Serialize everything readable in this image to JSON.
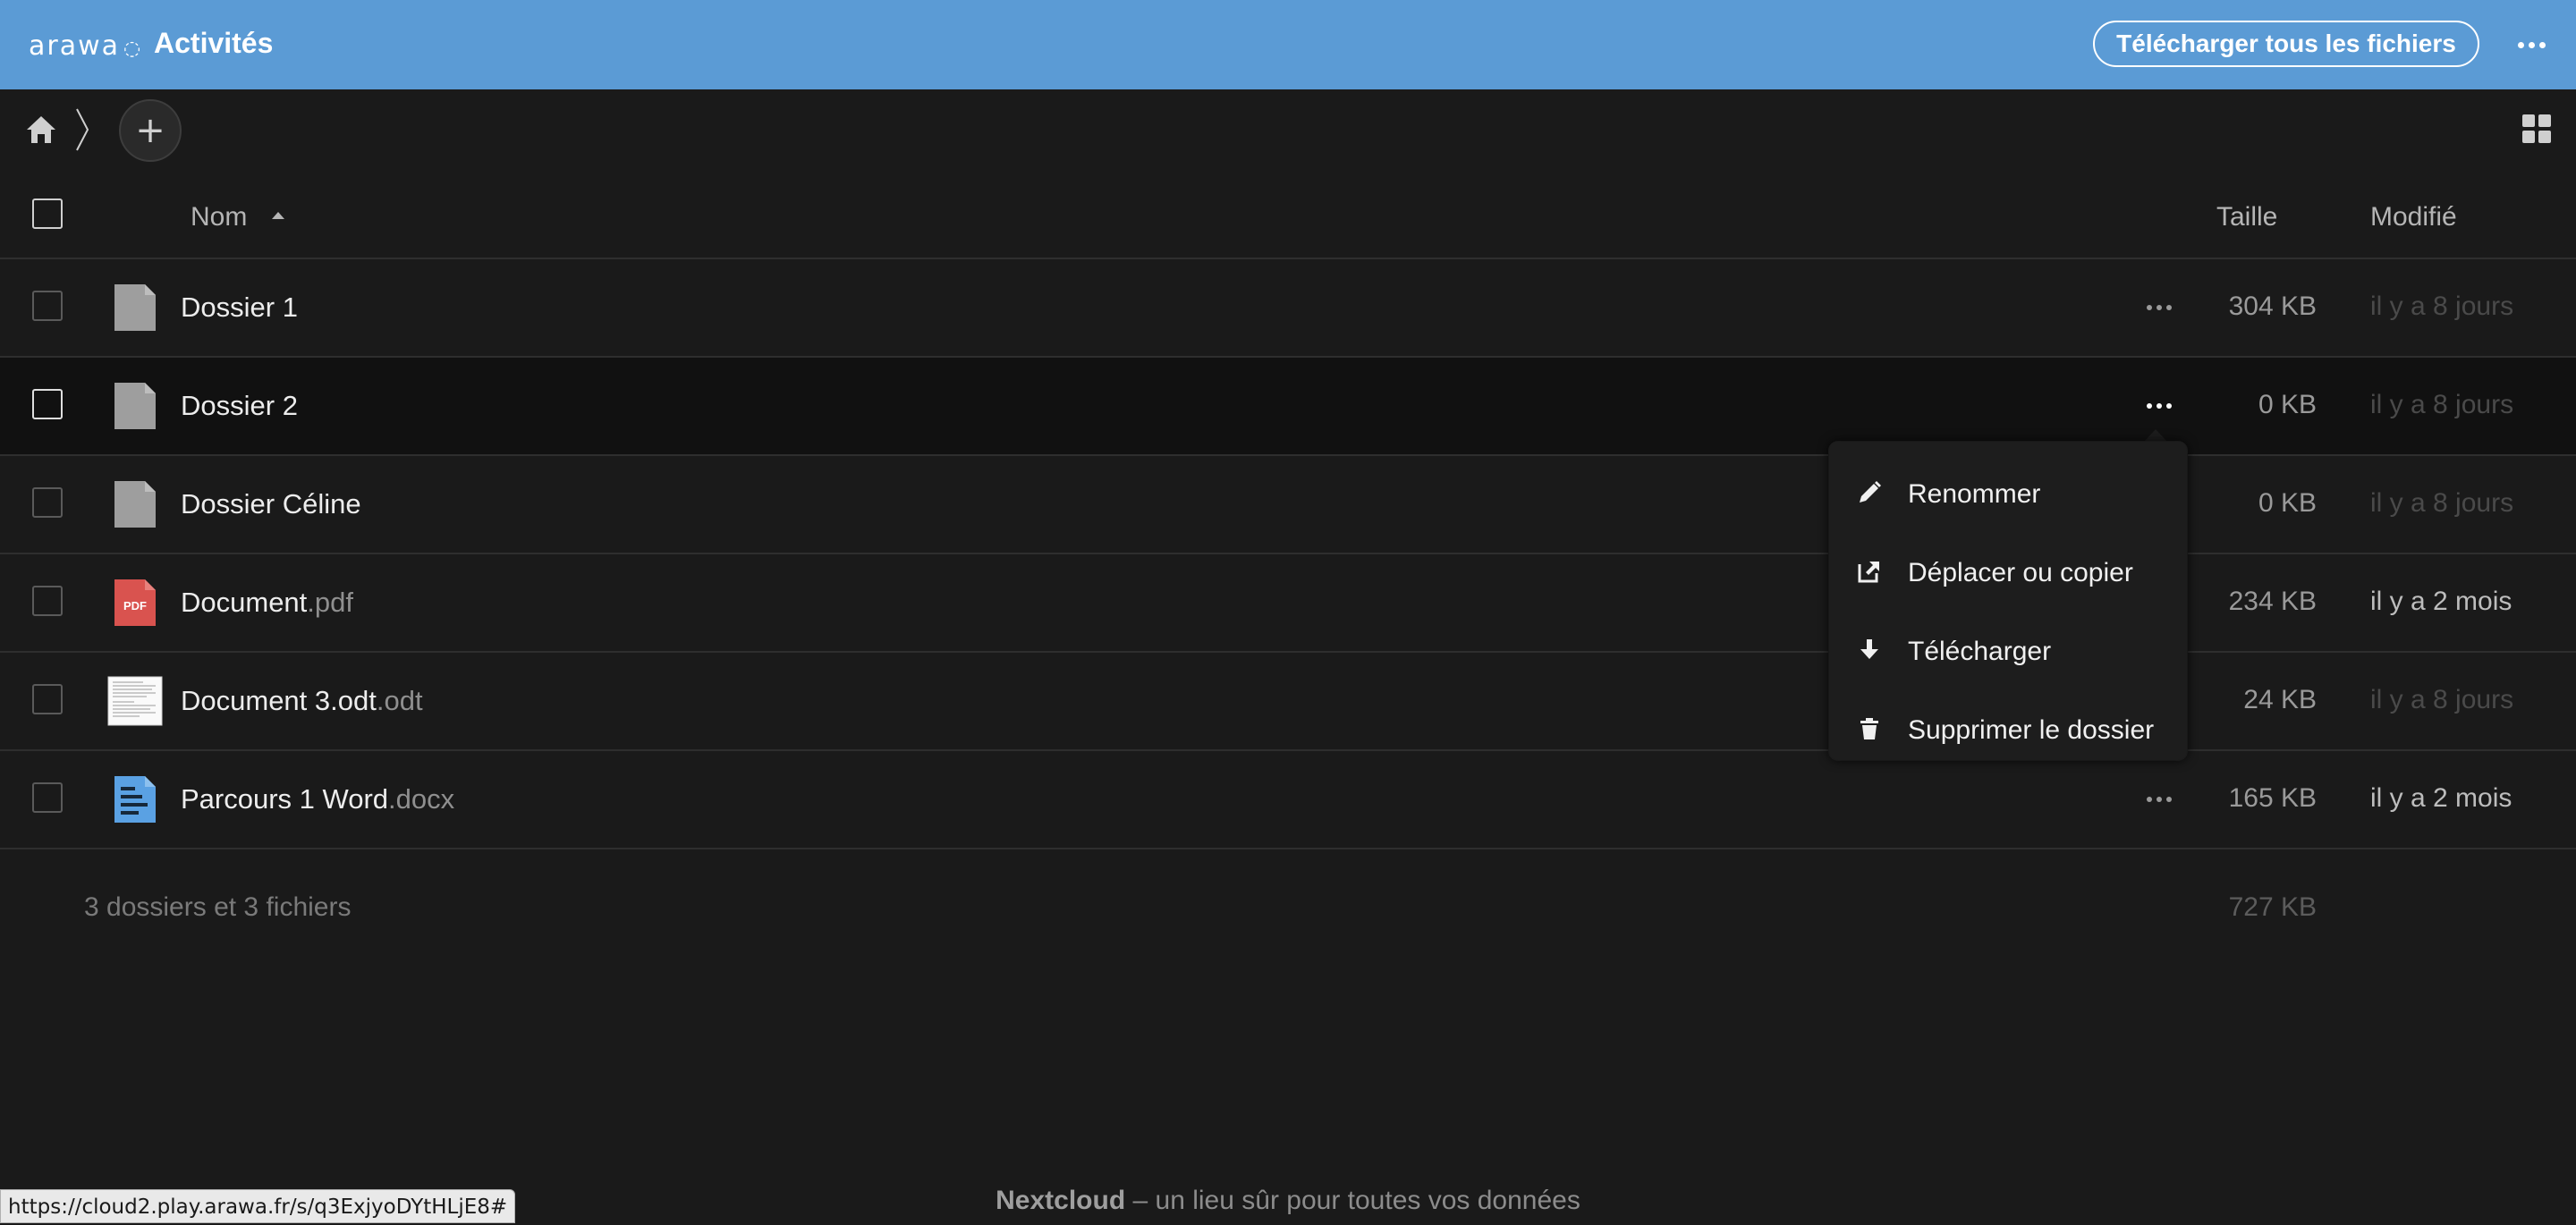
{
  "header": {
    "logo_text": "arawa",
    "logo_mark": "◌",
    "title": "Activités",
    "download_all_label": "Télécharger tous les fichiers",
    "more_icon": "ellipsis-icon"
  },
  "breadcrumb": {
    "home_icon": "home-icon",
    "new_icon": "+"
  },
  "table": {
    "col_name": "Nom",
    "col_size": "Taille",
    "col_modified": "Modifié",
    "rows": [
      {
        "name": "Dossier 1",
        "ext": "",
        "size": "304 KB",
        "modified": "il y a 8 jours",
        "icon": "folder-icon"
      },
      {
        "name": "Dossier 2",
        "ext": "",
        "size": "0 KB",
        "modified": "il y a 8 jours",
        "icon": "folder-icon"
      },
      {
        "name": "Dossier Céline",
        "ext": "",
        "size": "0 KB",
        "modified": "il y a 8 jours",
        "icon": "folder-icon"
      },
      {
        "name": "Document",
        "ext": ".pdf",
        "size": "234 KB",
        "modified": "il y a 2 mois",
        "icon": "pdf-icon",
        "icon_label": "PDF"
      },
      {
        "name": "Document 3.odt",
        "ext": ".odt",
        "size": "24 KB",
        "modified": "il y a 8 jours",
        "icon": "document-thumbnail-icon"
      },
      {
        "name": "Parcours 1 Word",
        "ext": ".docx",
        "size": "165 KB",
        "modified": "il y a 2 mois",
        "icon": "word-document-icon"
      }
    ],
    "summary": "3 dossiers et 3 fichiers",
    "summary_size": "727 KB"
  },
  "context_menu": {
    "items": [
      {
        "label": "Renommer",
        "icon": "pencil-icon"
      },
      {
        "label": "Déplacer ou copier",
        "icon": "external-link-icon"
      },
      {
        "label": "Télécharger",
        "icon": "download-icon"
      },
      {
        "label": "Supprimer le dossier",
        "icon": "trash-icon"
      }
    ]
  },
  "footer": {
    "brand": "Nextcloud",
    "tagline": " – un lieu sûr pour toutes vos données"
  },
  "status_bar": {
    "url": "https://cloud2.play.arawa.fr/s/q3ExjyoDYtHLjE8#"
  },
  "colors": {
    "header_bg": "#5b9bd5",
    "page_bg": "#1a1a1a",
    "pdf_red": "#d9534f",
    "word_blue": "#5aa1e3"
  }
}
